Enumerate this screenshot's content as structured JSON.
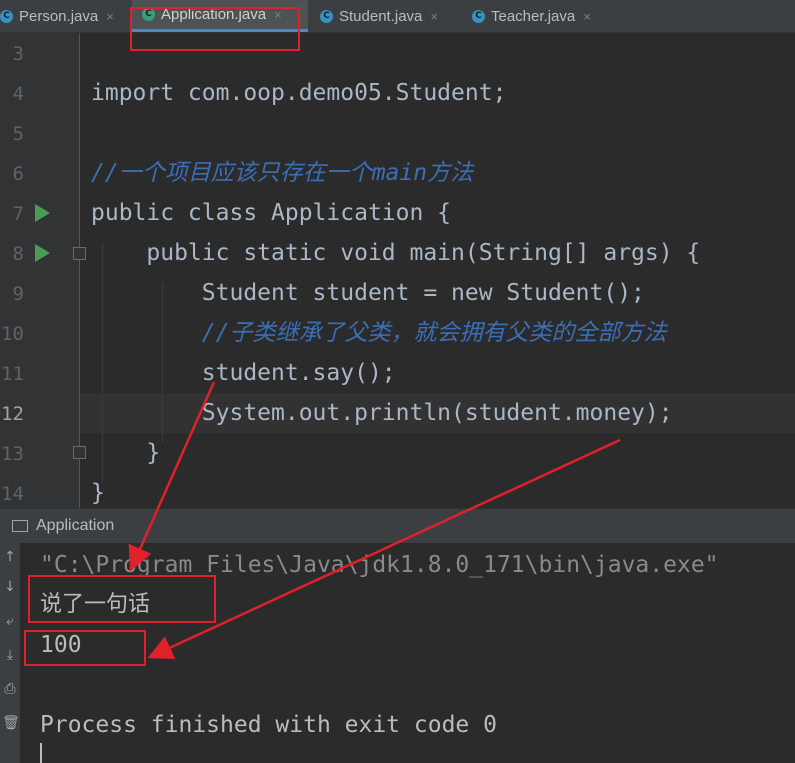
{
  "tabs": [
    {
      "name": "Person.java",
      "close": "×",
      "icon": "java-class-icon"
    },
    {
      "name": "Application.java",
      "close": "×",
      "icon": "java-class-icon",
      "active": true
    },
    {
      "name": "Student.java",
      "close": "×",
      "icon": "java-class-icon"
    },
    {
      "name": "Teacher.java",
      "close": "×",
      "icon": "java-class-icon"
    }
  ],
  "editor": {
    "line_numbers": [
      "3",
      "4",
      "5",
      "6",
      "7",
      "8",
      "9",
      "10",
      "11",
      "12",
      "13",
      "14"
    ],
    "current_line": "12",
    "lines": [
      "",
      "import com.oop.demo05.Student;",
      "",
      "//一个项目应该只存在一个main方法",
      "public class Application {",
      "    public static void main(String[] args) {",
      "        Student student = new Student();",
      "        //子类继承了父类，就会拥有父类的全部方法",
      "        student.say();",
      "        System.out.println(student.money);",
      "    }",
      "}"
    ]
  },
  "run_panel": {
    "title": "Application",
    "console_lines": [
      "\"C:\\Program Files\\Java\\jdk1.8.0_171\\bin\\java.exe\"",
      "说了一句话",
      "100",
      "",
      "Process finished with exit code 0"
    ]
  },
  "colors": {
    "annotation": "#e0202a",
    "keyword": "#cc7832",
    "comment": "#3a6fb7",
    "method": "#ffc66d",
    "field": "#9876aa",
    "run_icon": "#499c54"
  }
}
